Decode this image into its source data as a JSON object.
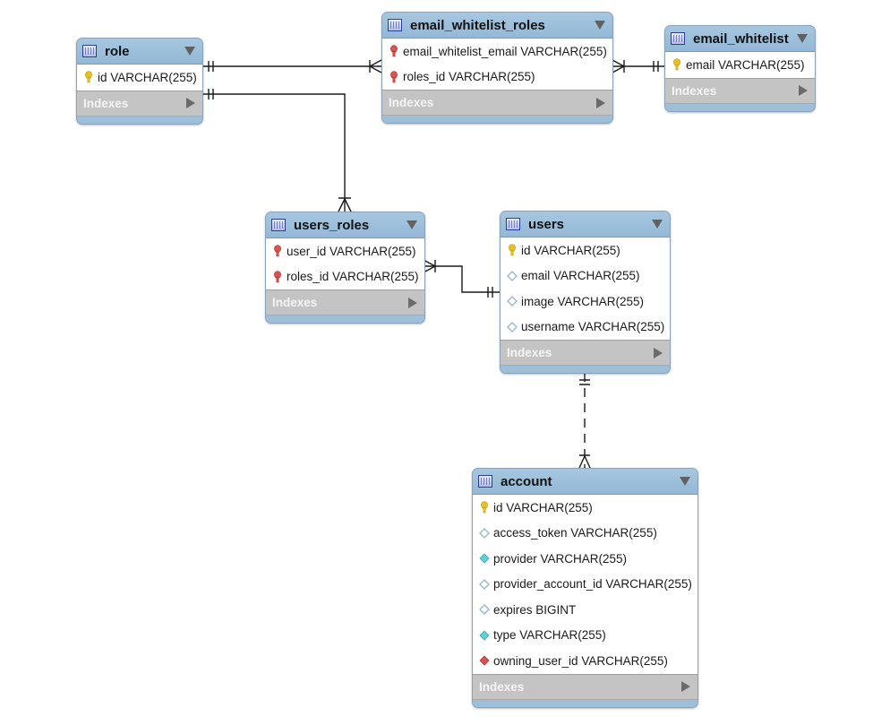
{
  "diagram": {
    "type": "entity-relationship",
    "indexes_label": "Indexes",
    "tables": [
      {
        "id": "role",
        "name": "role",
        "columns": [
          {
            "text": "id VARCHAR(255)",
            "icon": "primary-key-icon"
          }
        ]
      },
      {
        "id": "email_whitelist_roles",
        "name": "email_whitelist_roles",
        "columns": [
          {
            "text": "email_whitelist_email VARCHAR(255)",
            "icon": "foreign-primary-key-icon"
          },
          {
            "text": "roles_id VARCHAR(255)",
            "icon": "foreign-primary-key-icon"
          }
        ]
      },
      {
        "id": "email_whitelist",
        "name": "email_whitelist",
        "columns": [
          {
            "text": "email VARCHAR(255)",
            "icon": "primary-key-icon"
          }
        ]
      },
      {
        "id": "users_roles",
        "name": "users_roles",
        "columns": [
          {
            "text": "user_id VARCHAR(255)",
            "icon": "foreign-primary-key-icon"
          },
          {
            "text": "roles_id VARCHAR(255)",
            "icon": "foreign-primary-key-icon"
          }
        ]
      },
      {
        "id": "users",
        "name": "users",
        "columns": [
          {
            "text": "id VARCHAR(255)",
            "icon": "primary-key-icon"
          },
          {
            "text": "email VARCHAR(255)",
            "icon": "nullable-column-icon"
          },
          {
            "text": "image VARCHAR(255)",
            "icon": "nullable-column-icon"
          },
          {
            "text": "username VARCHAR(255)",
            "icon": "nullable-column-icon"
          }
        ]
      },
      {
        "id": "account",
        "name": "account",
        "columns": [
          {
            "text": "id VARCHAR(255)",
            "icon": "primary-key-icon"
          },
          {
            "text": "access_token VARCHAR(255)",
            "icon": "nullable-column-icon"
          },
          {
            "text": "provider VARCHAR(255)",
            "icon": "not-null-column-icon"
          },
          {
            "text": "provider_account_id VARCHAR(255)",
            "icon": "nullable-column-icon"
          },
          {
            "text": "expires BIGINT",
            "icon": "nullable-column-icon"
          },
          {
            "text": "type VARCHAR(255)",
            "icon": "not-null-column-icon"
          },
          {
            "text": "owning_user_id VARCHAR(255)",
            "icon": "foreign-key-icon"
          }
        ]
      }
    ],
    "relationships": [
      {
        "from": "role",
        "to": "email_whitelist_roles",
        "from_card": "one-and-only-one",
        "to_card": "one-or-many",
        "style": "solid"
      },
      {
        "from": "email_whitelist",
        "to": "email_whitelist_roles",
        "from_card": "one-and-only-one",
        "to_card": "one-or-many",
        "style": "solid"
      },
      {
        "from": "role",
        "to": "users_roles",
        "from_card": "one-and-only-one",
        "to_card": "one-or-many",
        "style": "solid"
      },
      {
        "from": "users",
        "to": "users_roles",
        "from_card": "one-and-only-one",
        "to_card": "one-or-many",
        "style": "solid"
      },
      {
        "from": "users",
        "to": "account",
        "from_card": "one-and-only-one",
        "to_card": "one-or-many",
        "style": "dashed"
      }
    ],
    "colors": {
      "header": "#9dbfda",
      "indexes_bg": "#c4c4c4",
      "primary_key": "#e8c21c",
      "foreign_key": "#d9534f",
      "not_null": "#5fd0d8",
      "nullable": "#8fb8c4"
    }
  }
}
